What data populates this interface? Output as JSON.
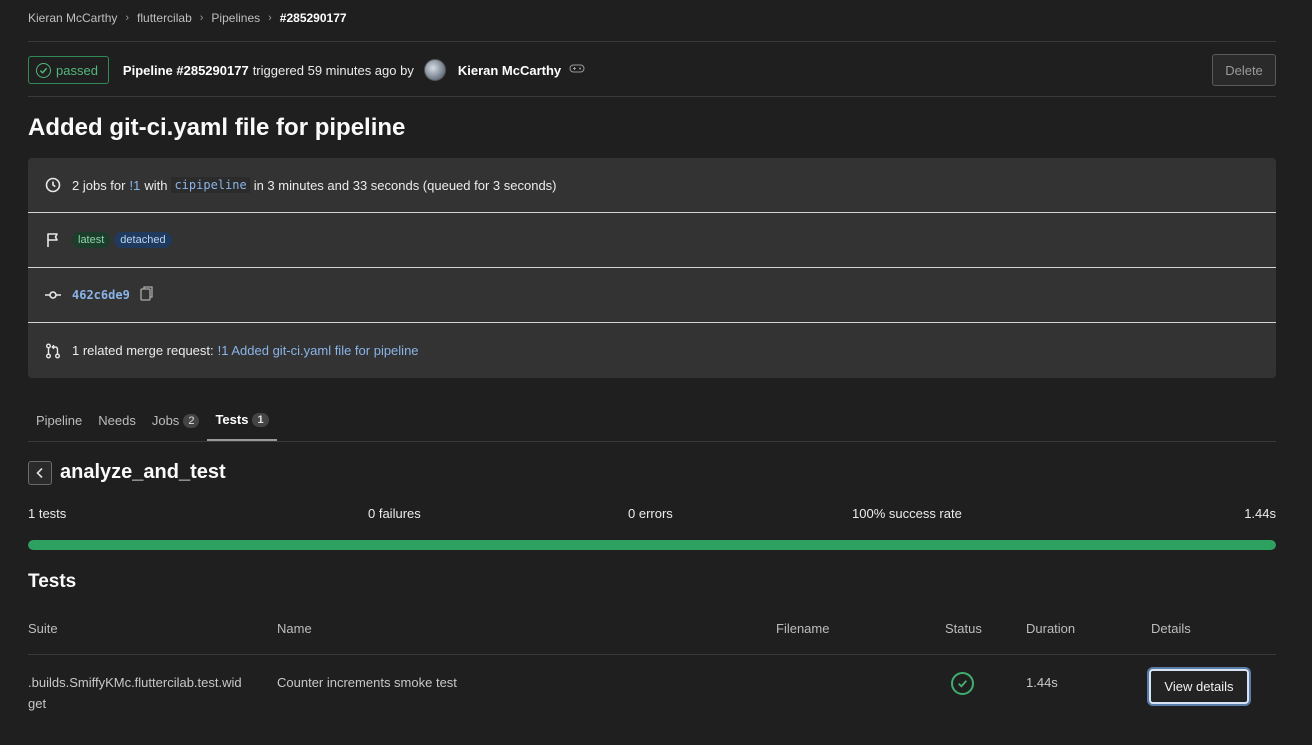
{
  "breadcrumb": {
    "items": [
      "Kieran McCarthy",
      "fluttercilab",
      "Pipelines"
    ],
    "current": "#285290177",
    "separator": "›"
  },
  "header": {
    "status": "passed",
    "pipeline_label": "Pipeline #285290177",
    "triggered_text": "triggered 59 minutes ago by",
    "user_name": "Kieran McCarthy",
    "delete_label": "Delete"
  },
  "page_title": "Added git-ci.yaml file for pipeline",
  "info": {
    "jobs_prefix": "2 jobs for",
    "mr_ref": "!1",
    "with_text": "with",
    "config_file": "cipipeline",
    "duration_text": "in 3 minutes and 33 seconds (queued for 3 seconds)",
    "tags": [
      "latest",
      "detached"
    ],
    "commit_sha": "462c6de9",
    "related_prefix": "1 related merge request:",
    "related_link": "!1 Added git-ci.yaml file for pipeline"
  },
  "tabs": [
    {
      "label": "Pipeline",
      "count": ""
    },
    {
      "label": "Needs",
      "count": ""
    },
    {
      "label": "Jobs",
      "count": "2"
    },
    {
      "label": "Tests",
      "count": "1",
      "active": true
    }
  ],
  "suite": {
    "name": "analyze_and_test",
    "tests": "1 tests",
    "failures": "0 failures",
    "errors": "0 errors",
    "success_rate": "100% success rate",
    "duration": "1.44s",
    "progress_fraction": 1.0
  },
  "tests_section": {
    "title": "Tests",
    "columns": [
      "Suite",
      "Name",
      "Filename",
      "Status",
      "Duration",
      "Details"
    ],
    "rows": [
      {
        "suite": ".builds.SmiffyKMc.fluttercilab.test.widget",
        "name": "Counter increments smoke test",
        "filename": "",
        "status": "success",
        "duration": "1.44s",
        "details_label": "View details"
      }
    ]
  },
  "colors": {
    "success": "#2da160",
    "link": "#8ab4e8",
    "background": "#1f1f1f"
  }
}
